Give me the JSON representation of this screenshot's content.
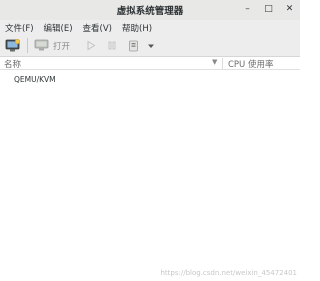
{
  "window": {
    "title": "虚拟系统管理器",
    "minimize_glyph": "–",
    "maximize_glyph": "□",
    "close_glyph": "✕"
  },
  "menubar": {
    "items": [
      {
        "label": "文件(F)"
      },
      {
        "label": "编辑(E)"
      },
      {
        "label": "查看(V)"
      },
      {
        "label": "帮助(H)"
      }
    ]
  },
  "toolbar": {
    "new_vm_icon": "new-vm-icon",
    "open_label": "打开",
    "run_icon": "play-icon",
    "pause_icon": "pause-icon",
    "shutdown_icon": "shutdown-icon",
    "menu_icon": "dropdown-arrow-icon"
  },
  "columns": {
    "name": "名称",
    "sort_glyph": "▼",
    "cpu": "CPU 使用率"
  },
  "connections": [
    {
      "name": "QEMU/KVM"
    }
  ],
  "watermark": "https://blog.csdn.net/weixin_45472401"
}
